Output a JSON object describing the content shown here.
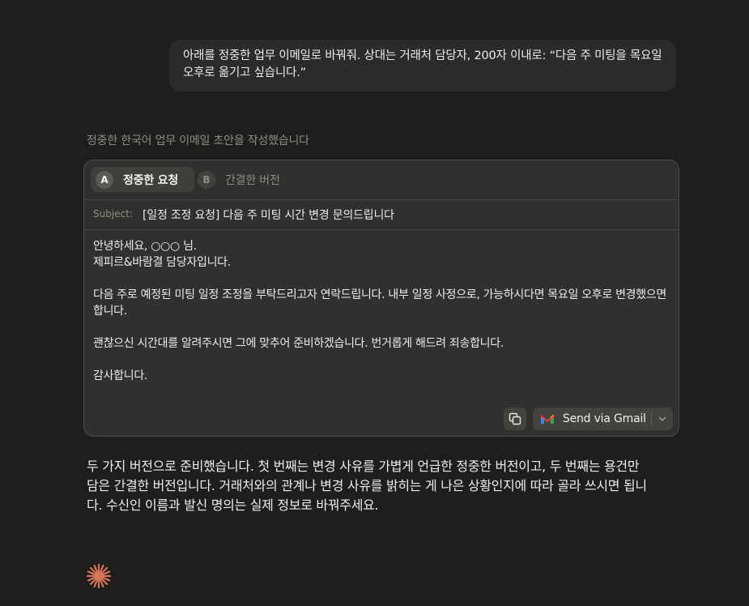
{
  "user_message": {
    "text": "아래를 정중한 업무 이메일로 바꿔줘. 상대는 거래처 담당자, 200자 이내로: “다음 주 미팅을 목요일 오후로 옮기고 싶습니다.”"
  },
  "assistant": {
    "status": "정중한 한국어 업무 이메일 초안을 작성했습니다",
    "reply": "두 가지 버전으로 준비했습니다. 첫 번째는 변경 사유를 가볍게 언급한 정중한 버전이고, 두 번째는 용건만 담은 간결한 버전입니다. 거래처와의 관계나 변경 사유를 밝히는 게 나은 상황인지에 따라 골라 쓰시면 됩니다. 수신인 이름과 발신 명의는 실제 정보로 바꿔주세요."
  },
  "email_artifact": {
    "tabs": [
      {
        "badge": "A",
        "label": "정중한 요청",
        "active": true
      },
      {
        "badge": "B",
        "label": "간결한 버전",
        "active": false
      }
    ],
    "subject_label": "Subject:",
    "subject": "[일정 조정 요청] 다음 주 미팅 시간 변경 문의드립니다",
    "body": {
      "greeting_line1": "안녕하세요, ○○○ 님.",
      "greeting_line2": "제피르&바람결 담당자입니다.",
      "paragraph1": "다음 주로 예정된 미팅 일정 조정을 부탁드리고자 연락드립니다. 내부 일정 사정으로, 가능하시다면 목요일 오후로 변경했으면 합니다.",
      "paragraph2": "괜찮으신 시간대를 알려주시면 그에 맞추어 준비하겠습니다. 번거롭게 해드려 죄송합니다.",
      "closing": "감사합니다."
    },
    "actions": {
      "copy_icon": "copy-icon",
      "send_label": "Send via Gmail",
      "gmail_icon": "gmail-icon",
      "dropdown_icon": "chevron-down-icon"
    }
  },
  "colors": {
    "background": "#1f1e1d",
    "accent_spark": "#d97757"
  }
}
